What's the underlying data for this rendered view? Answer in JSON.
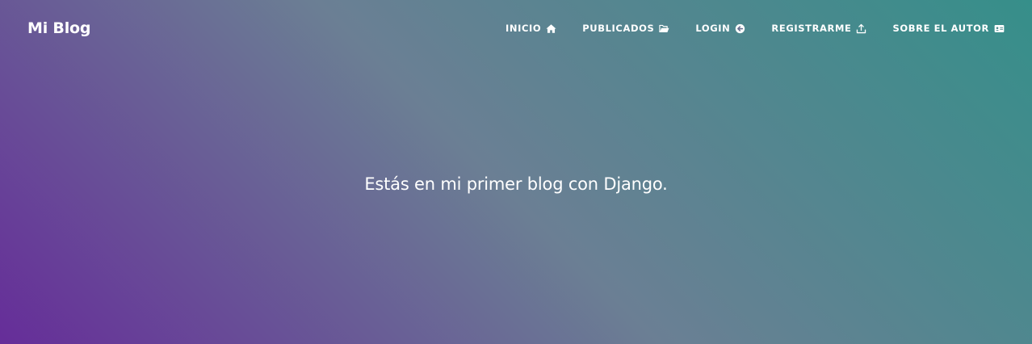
{
  "brand": {
    "label": "Mi Blog"
  },
  "nav": {
    "items": [
      {
        "label": "INICIO",
        "icon": "home-icon"
      },
      {
        "label": "PUBLICADOS",
        "icon": "folder-open-icon"
      },
      {
        "label": "LOGIN",
        "icon": "arrow-circle-left-icon"
      },
      {
        "label": "REGISTRARME",
        "icon": "upload-icon"
      },
      {
        "label": "SOBRE EL AUTOR",
        "icon": "id-card-icon"
      }
    ]
  },
  "hero": {
    "text": "Estás en mi primer blog con Django."
  },
  "colors": {
    "gradient_start": "#662d99",
    "gradient_mid": "#6b7f94",
    "gradient_end": "#368f8a",
    "text": "#ffffff"
  }
}
